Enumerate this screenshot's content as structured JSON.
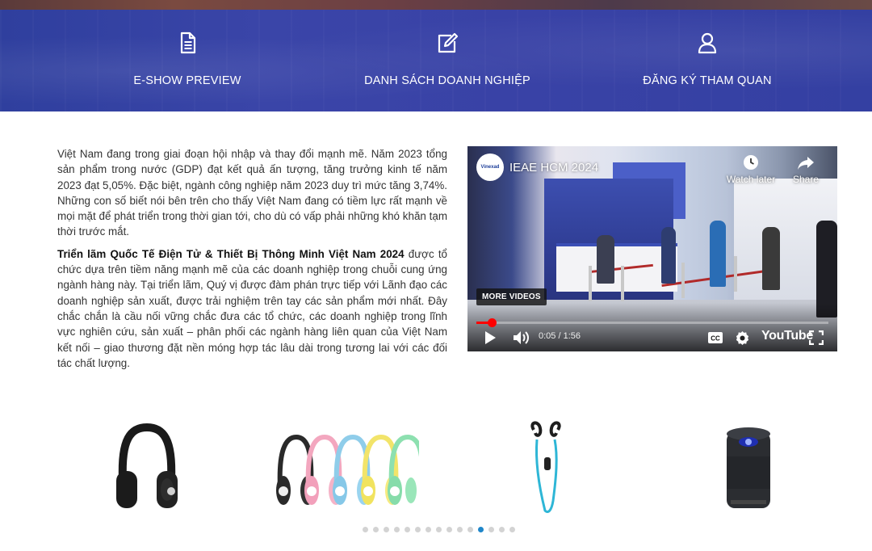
{
  "banner": {
    "items": [
      {
        "label": "E-SHOW PREVIEW",
        "icon": "document-icon"
      },
      {
        "label": "DANH SÁCH DOANH NGHIỆP",
        "icon": "edit-icon"
      },
      {
        "label": "ĐĂNG KÝ THAM QUAN",
        "icon": "user-icon"
      }
    ],
    "color": "#3a45a8"
  },
  "article": {
    "p1": "Việt Nam đang trong giai đoạn hội nhập và thay đổi mạnh mẽ. Năm 2023 tổng sản phẩm trong nước (GDP) đạt kết quả ấn tượng, tăng trưởng kinh tế năm 2023 đạt 5,05%. Đặc biệt, ngành công nghiệp năm 2023 duy trì mức tăng 3,74%. Những con số biết nói bên trên cho thấy Việt Nam đang có tiềm lực rất mạnh về mọi mặt để phát triển trong thời gian tới, cho dù có vấp phải những khó khăn tạm thời trước mắt.",
    "p2_bold": "Triển lãm Quốc Tế Điện Tử & Thiết Bị Thông Minh Việt Nam 2024",
    "p2_rest": " được tổ chức dựa trên tiềm năng mạnh mẽ của các doanh nghiệp trong chuỗi cung ứng ngành hàng này. Tại triển lãm, Quý vị được đàm phán trực tiếp với Lãnh đạo các doanh nghiệp sản xuất, được trải nghiệm trên tay các sản phẩm mới nhất. Đây chắc chắn là cầu nối vững chắc đưa các tổ chức, các doanh nghiệp trong lĩnh vực nghiên cứu, sản xuất – phân phối các ngành hàng liên quan của Việt Nam kết nối – giao thương đặt nền móng hợp tác lâu dài trong tương lai với các đối tác chất lượng."
  },
  "video": {
    "title": "IEAE HCM 2024",
    "channel_logo_text": "Vinexad",
    "watch_later": "Watch later",
    "share": "Share",
    "more_videos": "MORE VIDEOS",
    "time": "0:05 / 1:56",
    "progress": 0.043,
    "brand": "YouTube"
  },
  "carousel": {
    "products": [
      {
        "name": "headphones",
        "icon": "headphones-icon"
      },
      {
        "name": "headphones-colors",
        "icon": "colorful-headphones-icon"
      },
      {
        "name": "sport-earphones",
        "icon": "earphones-icon"
      },
      {
        "name": "mini-projector",
        "icon": "projector-icon"
      }
    ],
    "dot_count": 15,
    "active_dot": 11,
    "active_color": "#1f86c9"
  }
}
